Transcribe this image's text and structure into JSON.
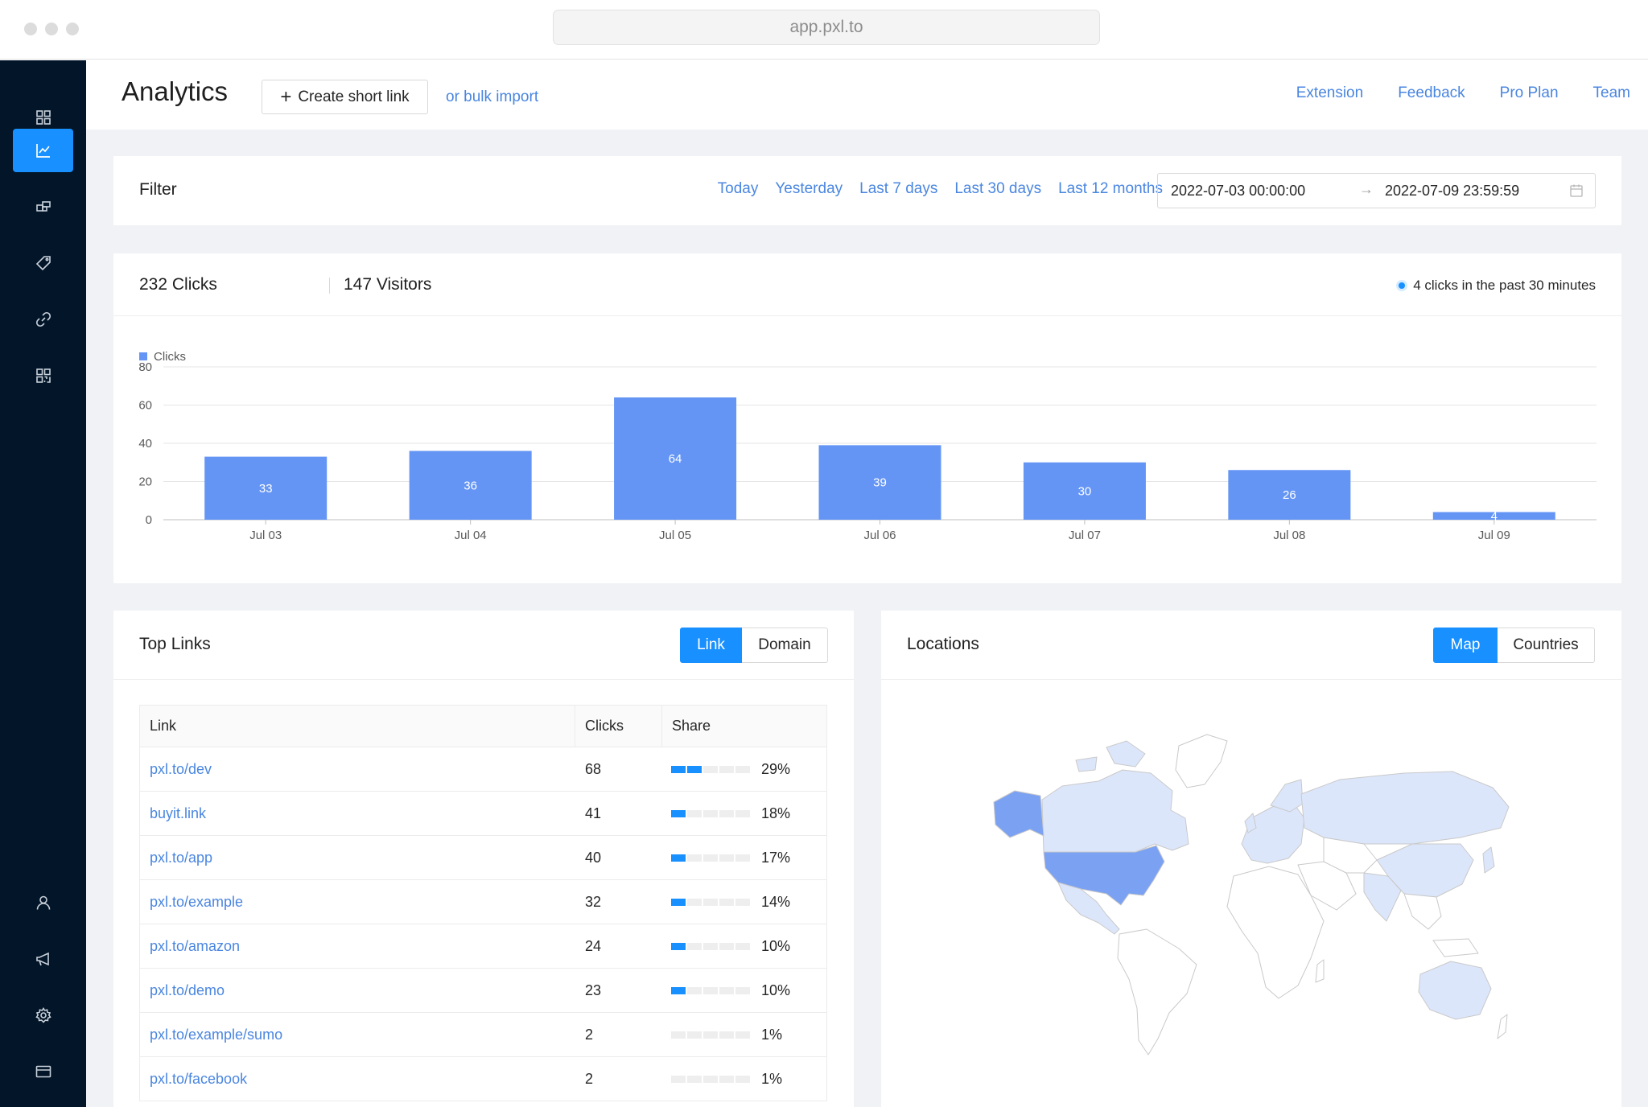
{
  "browser": {
    "url": "app.pxl.to"
  },
  "sidebar": {
    "top_items": [
      {
        "icon": "dashboard-icon",
        "active": false
      },
      {
        "icon": "analytics-icon",
        "active": true
      },
      {
        "icon": "domains-icon",
        "active": false
      },
      {
        "icon": "tag-icon",
        "active": false
      },
      {
        "icon": "link-icon",
        "active": false
      },
      {
        "icon": "qr-code-icon",
        "active": false
      }
    ],
    "bottom_items": [
      {
        "icon": "user-icon"
      },
      {
        "icon": "megaphone-icon"
      },
      {
        "icon": "gear-icon"
      },
      {
        "icon": "credit-card-icon"
      }
    ]
  },
  "header": {
    "title": "Analytics",
    "create_label": "Create short link",
    "bulk_label": "or bulk import",
    "nav": [
      "Extension",
      "Feedback",
      "Pro Plan",
      "Team"
    ]
  },
  "filter": {
    "title": "Filter",
    "ranges": [
      "Today",
      "Yesterday",
      "Last 7 days",
      "Last 30 days",
      "Last 12 months"
    ],
    "start": "2022-07-03 00:00:00",
    "end": "2022-07-09 23:59:59"
  },
  "stats": {
    "clicks_label": "232 Clicks",
    "visitors_label": "147 Visitors",
    "realtime_label": "4 clicks in the past 30 minutes"
  },
  "chart_data": {
    "type": "bar",
    "categories": [
      "Jul 03",
      "Jul 04",
      "Jul 05",
      "Jul 06",
      "Jul 07",
      "Jul 08",
      "Jul 09"
    ],
    "series": [
      {
        "name": "Clicks",
        "values": [
          33,
          36,
          64,
          39,
          30,
          26,
          4
        ]
      }
    ],
    "ylim": [
      0,
      80
    ],
    "yticks": [
      0,
      20,
      40,
      60,
      80
    ],
    "grid": true,
    "legend": "top-left",
    "color": "#6495f5"
  },
  "top_links": {
    "title": "Top Links",
    "toggle": [
      "Link",
      "Domain"
    ],
    "columns": [
      "Link",
      "Clicks",
      "Share"
    ],
    "rows": [
      {
        "link": "pxl.to/dev",
        "clicks": "68",
        "share": "29%",
        "fraction": 0.29
      },
      {
        "link": "buyit.link",
        "clicks": "41",
        "share": "18%",
        "fraction": 0.18
      },
      {
        "link": "pxl.to/app",
        "clicks": "40",
        "share": "17%",
        "fraction": 0.17
      },
      {
        "link": "pxl.to/example",
        "clicks": "32",
        "share": "14%",
        "fraction": 0.14
      },
      {
        "link": "pxl.to/amazon",
        "clicks": "24",
        "share": "10%",
        "fraction": 0.1
      },
      {
        "link": "pxl.to/demo",
        "clicks": "23",
        "share": "10%",
        "fraction": 0.1
      },
      {
        "link": "pxl.to/example/sumo",
        "clicks": "2",
        "share": "1%",
        "fraction": 0.01
      },
      {
        "link": "pxl.to/facebook",
        "clicks": "2",
        "share": "1%",
        "fraction": 0.01
      }
    ]
  },
  "locations": {
    "title": "Locations",
    "toggle": [
      "Map",
      "Countries"
    ],
    "colors": {
      "high": "#7ba1f2",
      "low": "#dce6fb",
      "none": "#ffffff",
      "border": "#c9c9c9"
    }
  }
}
